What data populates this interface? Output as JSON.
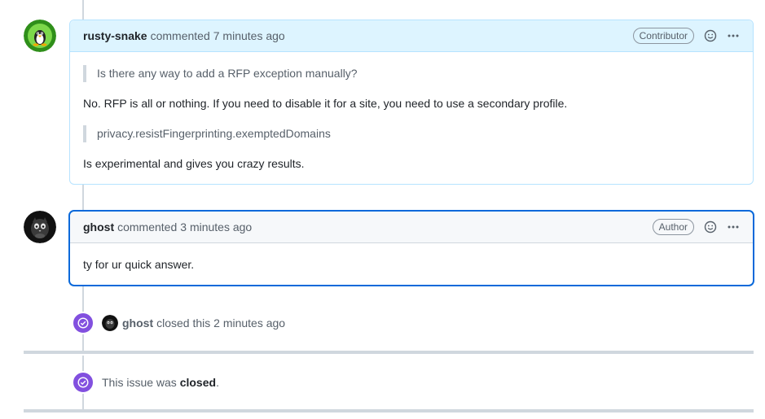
{
  "comments": [
    {
      "author": "rusty-snake",
      "action": "commented",
      "time": "7 minutes ago",
      "badge": "Contributor",
      "quote1": "Is there any way to add a RFP exception manually?",
      "para1": "No. RFP is all or nothing. If you need to disable it for a site, you need to use a secondary profile.",
      "quote2": "privacy.resistFingerprinting.exemptedDomains",
      "para2": "Is experimental and gives you crazy results."
    },
    {
      "author": "ghost",
      "action": "commented",
      "time": "3 minutes ago",
      "badge": "Author",
      "para1": "ty for ur quick answer."
    }
  ],
  "events": {
    "closed_event": {
      "actor": "ghost",
      "text": "closed this 2 minutes ago"
    },
    "closed_notice": {
      "prefix": "This issue was",
      "state": "closed",
      "suffix": "."
    }
  },
  "colors": {
    "accent": "#0969da",
    "closed_purple": "#8250df",
    "header_blue": "#ddf4ff"
  },
  "icons": {
    "emoji": "smiley-icon",
    "menu": "kebab-horizontal-icon",
    "closed": "issue-closed-icon"
  }
}
